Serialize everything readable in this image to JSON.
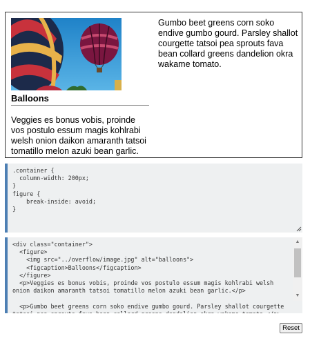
{
  "preview": {
    "caption": "Balloons",
    "image_alt": "balloons",
    "para1": "Veggies es bonus vobis, proinde vos postulo essum magis kohlrabi welsh onion daikon amaranth tatsoi tomatillo melon azuki bean garlic.",
    "para2": "Gumbo beet greens corn soko endive gumbo gourd. Parsley shallot courgette tatsoi pea sprouts fava bean collard greens dandelion okra wakame tomato."
  },
  "css_editor": {
    "code": ".container {\n  column-width: 200px;\n}\nfigure {\n    break-inside: avoid;\n}"
  },
  "html_editor": {
    "code": "<div class=\"container\">\n  <figure>\n    <img src=\"../overflow/image.jpg\" alt=\"balloons\">\n    <figcaption>Balloons</figcaption>\n  </figure>\n  <p>Veggies es bonus vobis, proinde vos postulo essum magis kohlrabi welsh onion daikon amaranth tatsoi tomatillo melon azuki bean garlic.</p>\n\n  <p>Gumbo beet greens corn soko endive gumbo gourd. Parsley shallot courgette tatsoi pea sprouts fava bean collard greens dandelion okra wakame tomato.</p>\n</div>"
  },
  "reset_label": "Reset",
  "colors": {
    "editor_bg": "#eef0f1",
    "editor_accent": "#4d7fb3",
    "sky": "#2f8fd0"
  }
}
